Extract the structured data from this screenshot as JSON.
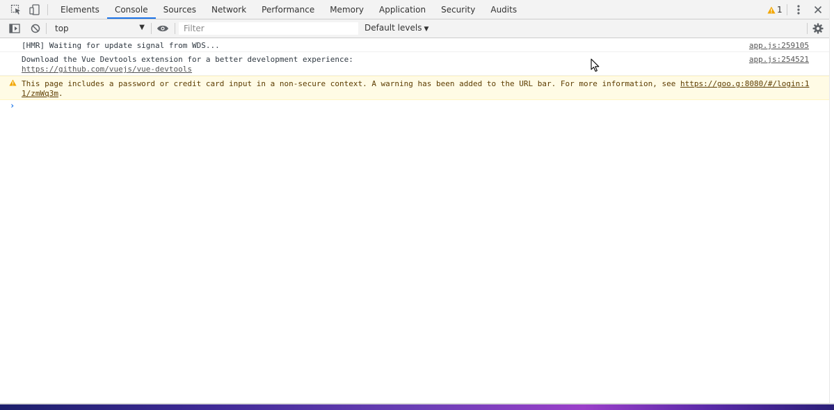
{
  "tabs": [
    {
      "label": "Elements",
      "active": false
    },
    {
      "label": "Console",
      "active": true
    },
    {
      "label": "Sources",
      "active": false
    },
    {
      "label": "Network",
      "active": false
    },
    {
      "label": "Performance",
      "active": false
    },
    {
      "label": "Memory",
      "active": false
    },
    {
      "label": "Application",
      "active": false
    },
    {
      "label": "Security",
      "active": false
    },
    {
      "label": "Audits",
      "active": false
    }
  ],
  "warnings": {
    "count": "1"
  },
  "toolbar": {
    "context": "top",
    "filter_placeholder": "Filter",
    "levels_label": "Default levels"
  },
  "messages": [
    {
      "level": "log",
      "text": "[HMR] Waiting for update signal from WDS...",
      "source": "app.js:259105"
    },
    {
      "level": "log",
      "text": "Download the Vue Devtools extension for a better development experience:",
      "link": "https://github.com/vuejs/vue-devtools",
      "source": "app.js:254521"
    },
    {
      "level": "warning",
      "text_before": "This page includes a password or credit card input in a non-secure context. A warning has been added to the URL bar. For more information, see ",
      "link_line1": "https://goo.g",
      "link_tail_line1": ":8080/#/login:1",
      "link_line2": "1/zmWq3m",
      "text_after": "."
    }
  ],
  "prompt": {
    "glyph": "›"
  },
  "colors": {
    "accent": "#1a73e8",
    "warning_bg": "#fffbe5",
    "warning_text": "#5c3c00",
    "warning_icon": "#f2a600",
    "toolbar_bg": "#f3f3f3"
  }
}
